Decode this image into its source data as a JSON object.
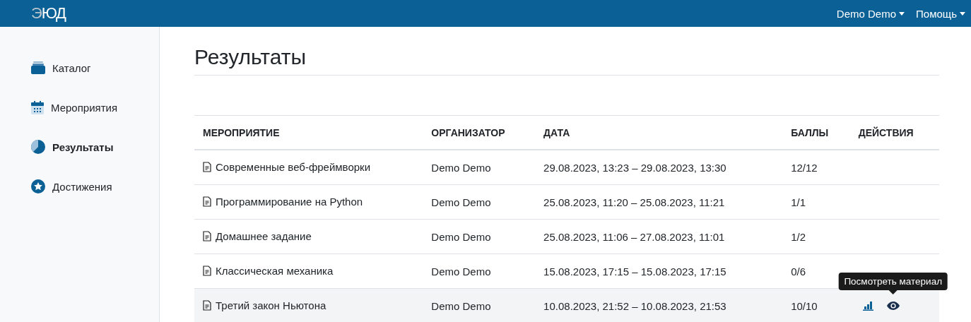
{
  "navbar": {
    "logo": {
      "mark": "Э",
      "text": "ЮД"
    },
    "menus": [
      {
        "label": "Demo Demo"
      },
      {
        "label": "Помощь"
      }
    ]
  },
  "sidebar": {
    "items": [
      {
        "label": "Каталог",
        "selected": false
      },
      {
        "label": "Мероприятия",
        "selected": false
      },
      {
        "label": "Результаты",
        "selected": true
      },
      {
        "label": "Достижения",
        "selected": false
      }
    ]
  },
  "page": {
    "title": "Результаты"
  },
  "table": {
    "columns": [
      "МЕРОПРИЯТИЕ",
      "ОРГАНИЗАТОР",
      "ДАТА",
      "БАЛЛЫ",
      "ДЕЙСТВИЯ"
    ],
    "rows": [
      {
        "event": "Современные веб-фреймворки",
        "organizer": "Demo Demo",
        "date": "29.08.2023, 13:23 – 29.08.2023, 13:30",
        "score": "12/12",
        "hovered": false,
        "actions": []
      },
      {
        "event": "Программирование на Python",
        "organizer": "Demo Demo",
        "date": "25.08.2023, 11:20 – 25.08.2023, 11:21",
        "score": "1/1",
        "hovered": false,
        "actions": []
      },
      {
        "event": "Домашнее задание",
        "organizer": "Demo Demo",
        "date": "25.08.2023, 11:06 – 27.08.2023, 11:01",
        "score": "1/2",
        "hovered": false,
        "actions": []
      },
      {
        "event": "Классическая механика",
        "organizer": "Demo Demo",
        "date": "15.08.2023, 17:15 – 15.08.2023, 17:15",
        "score": "0/6",
        "hovered": false,
        "actions": []
      },
      {
        "event": "Третий закон Ньютона",
        "organizer": "Demo Demo",
        "date": "10.08.2023, 21:52 – 10.08.2023, 21:53",
        "score": "10/10",
        "hovered": true,
        "actions": [
          {
            "kind": "stats"
          },
          {
            "kind": "view",
            "tooltip": "Посмотреть материал"
          }
        ]
      }
    ]
  }
}
